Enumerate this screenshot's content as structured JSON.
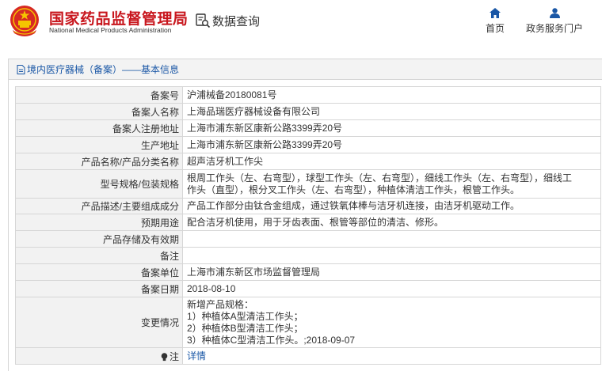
{
  "header": {
    "agency_cn": "国家药品监督管理局",
    "agency_en": "National Medical Products Administration",
    "query_title": "数据查询",
    "nav": [
      {
        "label": "首页",
        "icon": "home-icon"
      },
      {
        "label": "政务服务门户",
        "icon": "user-icon"
      }
    ]
  },
  "panel": {
    "title": "境内医疗器械（备案）——基本信息",
    "title_icon": "document-icon"
  },
  "records": [
    {
      "label": "备案号",
      "value": "沪浦械备20180081号"
    },
    {
      "label": "备案人名称",
      "value": "上海品瑞医疗器械设备有限公司"
    },
    {
      "label": "备案人注册地址",
      "value": "上海市浦东新区康新公路3399弄20号"
    },
    {
      "label": "生产地址",
      "value": "上海市浦东新区康新公路3399弄20号"
    },
    {
      "label": "产品名称/产品分类名称",
      "value": "超声洁牙机工作尖"
    },
    {
      "label": "型号规格/包装规格",
      "lines": [
        "根周工作头（左、右弯型），球型工作头（左、右弯型），细线工作头（左、右弯型），细线工",
        "作头（直型），根分叉工作头（左、右弯型），种植体清洁工作头，根管工作头。"
      ]
    },
    {
      "label": "产品描述/主要组成成分",
      "value": "产品工作部分由钛合金组成，通过铁氧体棒与洁牙机连接，由洁牙机驱动工作。"
    },
    {
      "label": "预期用途",
      "value": "配合洁牙机使用，用于牙齿表面、根管等部位的清洁、修形。"
    },
    {
      "label": "产品存储及有效期",
      "value": ""
    },
    {
      "label": "备注",
      "value": ""
    },
    {
      "label": "备案单位",
      "value": "上海市浦东新区市场监督管理局"
    },
    {
      "label": "备案日期",
      "value": "2018-08-10"
    },
    {
      "label": "变更情况",
      "lines": [
        "新增产品规格：",
        "1）种植体A型清洁工作头；",
        "2）种植体B型清洁工作头；",
        "3）种植体C型清洁工作头。;2018-09-07"
      ]
    },
    {
      "label": "注",
      "value": "详情",
      "icon": "lightbulb-icon"
    }
  ],
  "colors": {
    "brand_red": "#c8161d",
    "link_blue": "#1a57a6",
    "label_bg": "#f2f2f2",
    "border": "#d6d6d6"
  }
}
